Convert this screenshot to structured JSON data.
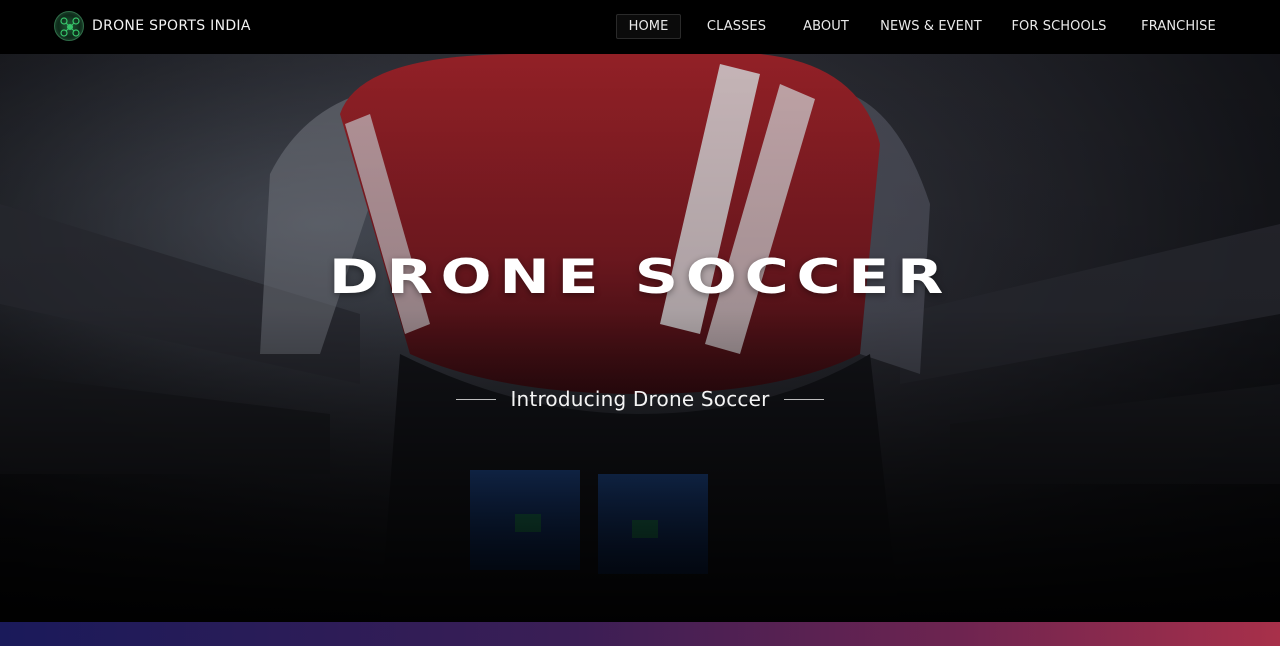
{
  "brand": {
    "name": "DRONE SPORTS INDIA",
    "logo_icon": "drone-logo-icon"
  },
  "nav": {
    "items": [
      {
        "label": "HOME",
        "active": true
      },
      {
        "label": "CLASSES",
        "active": false
      },
      {
        "label": "ABOUT",
        "active": false
      },
      {
        "label": "NEWS & EVENT",
        "active": false
      },
      {
        "label": "FOR SCHOOLS",
        "active": false
      },
      {
        "label": "FRANCHISE",
        "active": false
      }
    ]
  },
  "hero": {
    "title": "DRONE SOCCER",
    "subtitle": "Introducing Drone Soccer"
  },
  "colors": {
    "drone_red": "#b0262c",
    "band_start": "#1a1a5a",
    "band_end": "#a8304a"
  }
}
